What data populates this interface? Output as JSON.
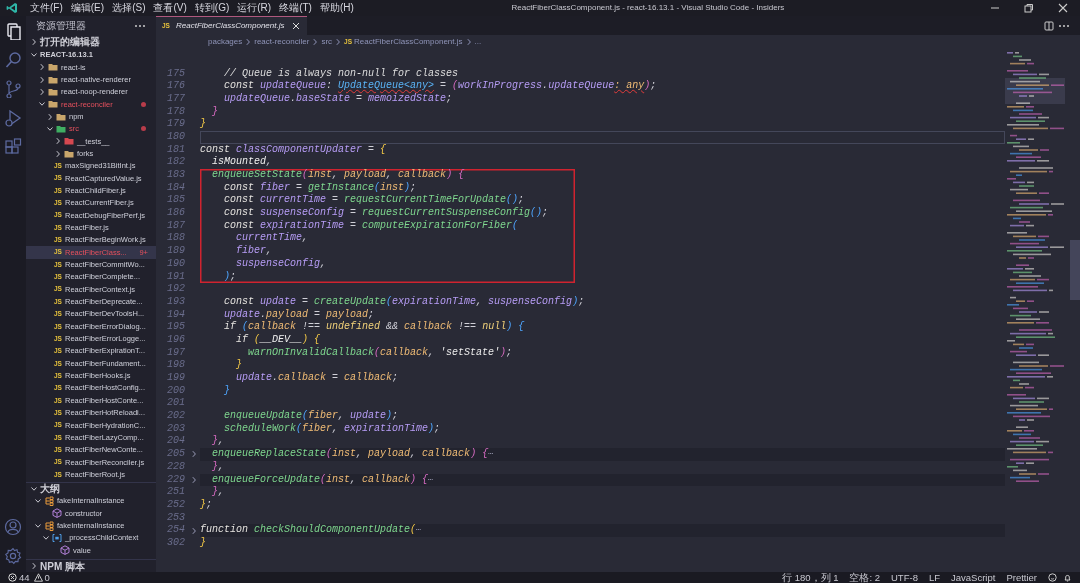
{
  "title_bar": {
    "menu": [
      "文件(F)",
      "编辑(E)",
      "选择(S)",
      "查看(V)",
      "转到(G)",
      "运行(R)",
      "终端(T)",
      "帮助(H)"
    ],
    "title": "ReactFiberClassComponent.js - react-16.13.1 - Visual Studio Code - Insiders"
  },
  "activity_bar": {
    "top": [
      {
        "kind": "files",
        "selected": true
      },
      {
        "kind": "search",
        "selected": false
      },
      {
        "kind": "source-control",
        "selected": false
      },
      {
        "kind": "run",
        "selected": false
      },
      {
        "kind": "extensions",
        "selected": false
      }
    ],
    "bottom": [
      {
        "kind": "account"
      },
      {
        "kind": "settings"
      }
    ]
  },
  "explorer": {
    "title": "资源管理器",
    "open_editors": {
      "title": "打开的编辑器",
      "expanded": false
    },
    "project": {
      "title": "REACT-16.13.1",
      "expanded": true,
      "children": [
        {
          "label": "react-is",
          "kind": "folder",
          "expanded": false,
          "selected": false,
          "modified": false
        },
        {
          "label": "react-native-renderer",
          "kind": "folder",
          "expanded": false,
          "selected": false,
          "modified": false
        },
        {
          "label": "react-noop-renderer",
          "kind": "folder",
          "expanded": false,
          "selected": false,
          "modified": false
        },
        {
          "label": "react-reconciler",
          "kind": "folder",
          "expanded": true,
          "selected": false,
          "modified": true,
          "children": [
            {
              "label": "npm",
              "kind": "folder",
              "expanded": false,
              "selected": false,
              "modified": false
            },
            {
              "label": "src",
              "kind": "src-folder",
              "expanded": true,
              "selected": false,
              "modified": true,
              "children": [
                {
                  "label": "__tests__",
                  "kind": "test-folder",
                  "expanded": false,
                  "selected": false,
                  "modified": false
                },
                {
                  "label": "forks",
                  "kind": "folder",
                  "expanded": false,
                  "selected": false,
                  "modified": false
                },
                {
                  "label": "maxSigned31BitInt.js",
                  "kind": "file",
                  "icon_label": "JS",
                  "selected": false,
                  "modified": false
                },
                {
                  "label": "ReactCapturedValue.js",
                  "kind": "file",
                  "icon_label": "JS",
                  "selected": false,
                  "modified": false
                },
                {
                  "label": "ReactChildFiber.js",
                  "kind": "file",
                  "icon_label": "JS",
                  "selected": false,
                  "modified": false
                },
                {
                  "label": "ReactCurrentFiber.js",
                  "kind": "file",
                  "icon_label": "JS",
                  "selected": false,
                  "modified": false
                },
                {
                  "label": "ReactDebugFiberPerf.js",
                  "kind": "file",
                  "icon_label": "JS",
                  "selected": false,
                  "modified": false
                },
                {
                  "label": "ReactFiber.js",
                  "kind": "file",
                  "icon_label": "JS",
                  "selected": false,
                  "modified": false
                },
                {
                  "label": "ReactFiberBeginWork.js",
                  "kind": "file",
                  "icon_label": "JS",
                  "selected": false,
                  "modified": false
                },
                {
                  "label": "ReactFiberClass...",
                  "kind": "file",
                  "icon_label": "JS",
                  "selected": true,
                  "modified": true,
                  "badge": "9+"
                },
                {
                  "label": "ReactFiberCommitWo...",
                  "kind": "file",
                  "icon_label": "JS",
                  "selected": false,
                  "modified": false
                },
                {
                  "label": "ReactFiberComplete...",
                  "kind": "file",
                  "icon_label": "JS",
                  "selected": false,
                  "modified": false
                },
                {
                  "label": "ReactFiberContext.js",
                  "kind": "file",
                  "icon_label": "JS",
                  "selected": false,
                  "modified": false
                },
                {
                  "label": "ReactFiberDeprecate...",
                  "kind": "file",
                  "icon_label": "JS",
                  "selected": false,
                  "modified": false
                },
                {
                  "label": "ReactFiberDevToolsH...",
                  "kind": "file",
                  "icon_label": "JS",
                  "selected": false,
                  "modified": false
                },
                {
                  "label": "ReactFiberErrorDialog...",
                  "kind": "file",
                  "icon_label": "JS",
                  "selected": false,
                  "modified": false
                },
                {
                  "label": "ReactFiberErrorLogge...",
                  "kind": "file",
                  "icon_label": "JS",
                  "selected": false,
                  "modified": false
                },
                {
                  "label": "ReactFiberExpirationT...",
                  "kind": "file",
                  "icon_label": "JS",
                  "selected": false,
                  "modified": false
                },
                {
                  "label": "ReactFiberFundament...",
                  "kind": "file",
                  "icon_label": "JS",
                  "selected": false,
                  "modified": false
                },
                {
                  "label": "ReactFiberHooks.js",
                  "kind": "file",
                  "icon_label": "JS",
                  "selected": false,
                  "modified": false
                },
                {
                  "label": "ReactFiberHostConfig...",
                  "kind": "file",
                  "icon_label": "JS",
                  "selected": false,
                  "modified": false
                },
                {
                  "label": "ReactFiberHostConte...",
                  "kind": "file",
                  "icon_label": "JS",
                  "selected": false,
                  "modified": false
                },
                {
                  "label": "ReactFiberHotReloadi...",
                  "kind": "file",
                  "icon_label": "JS",
                  "selected": false,
                  "modified": false
                },
                {
                  "label": "ReactFiberHydrationC...",
                  "kind": "file",
                  "icon_label": "JS",
                  "selected": false,
                  "modified": false
                },
                {
                  "label": "ReactFiberLazyComp...",
                  "kind": "file",
                  "icon_label": "JS",
                  "selected": false,
                  "modified": false
                },
                {
                  "label": "ReactFiberNewConte...",
                  "kind": "file",
                  "icon_label": "JS",
                  "selected": false,
                  "modified": false
                },
                {
                  "label": "ReactFiberReconciler.js",
                  "kind": "file",
                  "icon_label": "JS",
                  "selected": false,
                  "modified": false
                },
                {
                  "label": "ReactFiberRoot.js",
                  "kind": "file",
                  "icon_label": "JS",
                  "selected": false,
                  "modified": false
                }
              ]
            }
          ]
        }
      ]
    }
  },
  "outline": {
    "title": "大纲",
    "expanded": true,
    "children": [
      {
        "label": "fakeInternalInstance",
        "kind": "object",
        "expanded": true,
        "children": [
          {
            "label": "constructor",
            "kind": "method"
          }
        ]
      },
      {
        "label": "fakeInternalInstance",
        "kind": "object",
        "expanded": true,
        "children": [
          {
            "label": "_processChildContext",
            "kind": "variable",
            "expanded": true,
            "children": [
              {
                "label": "value",
                "kind": "method"
              }
            ]
          }
        ]
      }
    ]
  },
  "npm_scripts": {
    "title": "NPM 脚本",
    "expanded": false
  },
  "tabs": [
    {
      "label": "ReactFiberClassComponent.js",
      "icon_label": "JS",
      "selected": true
    }
  ],
  "breadcrumb": [
    {
      "text": "packages"
    },
    {
      "text": "react-reconciler"
    },
    {
      "text": "src"
    },
    {
      "text": "ReactFiberClassComponent.js",
      "icon_label": "JS"
    },
    {
      "text": "..."
    }
  ],
  "editor": {
    "lines": [
      {
        "number": "175",
        "tokens": [
          {
            "kind": "comment",
            "text": "    // Queue is always non-null for classes"
          }
        ]
      },
      {
        "number": "176",
        "tokens": [
          {
            "kind": "keyword",
            "text": "    const "
          },
          {
            "kind": "variable",
            "text": "updateQueue"
          },
          {
            "kind": "punct",
            "text": ": "
          },
          {
            "kind": "typeerror",
            "text": "UpdateQueue<any>"
          },
          {
            "kind": "punct",
            "text": " = "
          },
          {
            "kind": "brace2",
            "text": "("
          },
          {
            "kind": "variable",
            "text": "workInProgress"
          },
          {
            "kind": "punct",
            "text": "."
          },
          {
            "kind": "variable",
            "text": "updateQueue"
          },
          {
            "kind": "paramerror",
            "text": ": any"
          },
          {
            "kind": "brace2",
            "text": ")"
          },
          {
            "kind": "punct",
            "text": ";"
          }
        ]
      },
      {
        "number": "177",
        "tokens": [
          {
            "kind": "variable",
            "text": "    updateQueue"
          },
          {
            "kind": "punct",
            "text": "."
          },
          {
            "kind": "variable",
            "text": "baseState"
          },
          {
            "kind": "punct",
            "text": " = "
          },
          {
            "kind": "variable",
            "text": "memoizedState"
          },
          {
            "kind": "punct",
            "text": ";"
          }
        ]
      },
      {
        "number": "178",
        "tokens": [
          {
            "kind": "brace2",
            "text": "  }"
          }
        ]
      },
      {
        "number": "179",
        "tokens": [
          {
            "kind": "brace1",
            "text": "}"
          }
        ]
      },
      {
        "number": "180",
        "current": true
      },
      {
        "number": "181",
        "tokens": [
          {
            "kind": "keyword",
            "text": "const "
          },
          {
            "kind": "variable",
            "text": "classComponentUpdater"
          },
          {
            "kind": "punct",
            "text": " = "
          },
          {
            "kind": "brace1",
            "text": "{"
          }
        ]
      },
      {
        "number": "182",
        "tokens": [
          {
            "kind": "plain",
            "text": "  isMounted"
          },
          {
            "kind": "punct",
            "text": ","
          }
        ]
      },
      {
        "number": "183",
        "boxed": true,
        "tokens": [
          {
            "kind": "function",
            "text": "  enqueueSetState"
          },
          {
            "kind": "brace2",
            "text": "("
          },
          {
            "kind": "param",
            "text": "inst"
          },
          {
            "kind": "punct",
            "text": ", "
          },
          {
            "kind": "param",
            "text": "payload"
          },
          {
            "kind": "punct",
            "text": ", "
          },
          {
            "kind": "param",
            "text": "callback"
          },
          {
            "kind": "brace2",
            "text": ") {"
          }
        ]
      },
      {
        "number": "184",
        "boxed": true,
        "tokens": [
          {
            "kind": "keyword",
            "text": "    const "
          },
          {
            "kind": "variable",
            "text": "fiber"
          },
          {
            "kind": "punct",
            "text": " = "
          },
          {
            "kind": "function",
            "text": "getInstance"
          },
          {
            "kind": "brace3",
            "text": "("
          },
          {
            "kind": "param",
            "text": "inst"
          },
          {
            "kind": "brace3",
            "text": ")"
          },
          {
            "kind": "punct",
            "text": ";"
          }
        ]
      },
      {
        "number": "185",
        "boxed": true,
        "tokens": [
          {
            "kind": "keyword",
            "text": "    const "
          },
          {
            "kind": "variable",
            "text": "currentTime"
          },
          {
            "kind": "punct",
            "text": " = "
          },
          {
            "kind": "function",
            "text": "requestCurrentTimeForUpdate"
          },
          {
            "kind": "brace3",
            "text": "()"
          },
          {
            "kind": "punct",
            "text": ";"
          }
        ]
      },
      {
        "number": "186",
        "boxed": true,
        "tokens": [
          {
            "kind": "keyword",
            "text": "    const "
          },
          {
            "kind": "variable",
            "text": "suspenseConfig"
          },
          {
            "kind": "punct",
            "text": " = "
          },
          {
            "kind": "function",
            "text": "requestCurrentSuspenseConfig"
          },
          {
            "kind": "brace3",
            "text": "()"
          },
          {
            "kind": "punct",
            "text": ";"
          }
        ]
      },
      {
        "number": "187",
        "boxed": true,
        "tokens": [
          {
            "kind": "keyword",
            "text": "    const "
          },
          {
            "kind": "variable",
            "text": "expirationTime"
          },
          {
            "kind": "punct",
            "text": " = "
          },
          {
            "kind": "function",
            "text": "computeExpirationForFiber"
          },
          {
            "kind": "brace3",
            "text": "("
          }
        ]
      },
      {
        "number": "188",
        "boxed": true,
        "tokens": [
          {
            "kind": "variable",
            "text": "      currentTime"
          },
          {
            "kind": "punct",
            "text": ","
          }
        ]
      },
      {
        "number": "189",
        "boxed": true,
        "tokens": [
          {
            "kind": "variable",
            "text": "      fiber"
          },
          {
            "kind": "punct",
            "text": ","
          }
        ]
      },
      {
        "number": "190",
        "boxed": true,
        "tokens": [
          {
            "kind": "variable",
            "text": "      suspenseConfig"
          },
          {
            "kind": "punct",
            "text": ","
          }
        ]
      },
      {
        "number": "191",
        "boxed": true,
        "tokens": [
          {
            "kind": "brace3",
            "text": "    )"
          },
          {
            "kind": "punct",
            "text": ";"
          }
        ]
      },
      {
        "number": "192"
      },
      {
        "number": "193",
        "tokens": [
          {
            "kind": "keyword",
            "text": "    const "
          },
          {
            "kind": "variable",
            "text": "update"
          },
          {
            "kind": "punct",
            "text": " = "
          },
          {
            "kind": "function",
            "text": "createUpdate"
          },
          {
            "kind": "brace3",
            "text": "("
          },
          {
            "kind": "variable",
            "text": "expirationTime"
          },
          {
            "kind": "punct",
            "text": ", "
          },
          {
            "kind": "variable",
            "text": "suspenseConfig"
          },
          {
            "kind": "brace3",
            "text": ")"
          },
          {
            "kind": "punct",
            "text": ";"
          }
        ]
      },
      {
        "number": "194",
        "tokens": [
          {
            "kind": "variable",
            "text": "    update"
          },
          {
            "kind": "punct",
            "text": "."
          },
          {
            "kind": "param",
            "text": "payload"
          },
          {
            "kind": "punct",
            "text": " = "
          },
          {
            "kind": "param",
            "text": "payload"
          },
          {
            "kind": "punct",
            "text": ";"
          }
        ]
      },
      {
        "number": "195",
        "tokens": [
          {
            "kind": "keyword",
            "text": "    if "
          },
          {
            "kind": "brace3",
            "text": "("
          },
          {
            "kind": "param",
            "text": "callback"
          },
          {
            "kind": "punct",
            "text": " !== "
          },
          {
            "kind": "literal",
            "text": "undefined"
          },
          {
            "kind": "punct",
            "text": " && "
          },
          {
            "kind": "param",
            "text": "callback"
          },
          {
            "kind": "punct",
            "text": " !== "
          },
          {
            "kind": "literal",
            "text": "null"
          },
          {
            "kind": "brace3",
            "text": ") {"
          }
        ]
      },
      {
        "number": "196",
        "tokens": [
          {
            "kind": "keyword",
            "text": "      if "
          },
          {
            "kind": "brace1",
            "text": "("
          },
          {
            "kind": "plain",
            "text": "__DEV__"
          },
          {
            "kind": "brace1",
            "text": ") {"
          }
        ]
      },
      {
        "number": "197",
        "tokens": [
          {
            "kind": "function",
            "text": "        warnOnInvalidCallback"
          },
          {
            "kind": "brace2",
            "text": "("
          },
          {
            "kind": "param",
            "text": "callback"
          },
          {
            "kind": "punct",
            "text": ", "
          },
          {
            "kind": "string",
            "text": "'setState'"
          },
          {
            "kind": "brace2",
            "text": ")"
          },
          {
            "kind": "punct",
            "text": ";"
          }
        ]
      },
      {
        "number": "198",
        "tokens": [
          {
            "kind": "brace1",
            "text": "      }"
          }
        ]
      },
      {
        "number": "199",
        "tokens": [
          {
            "kind": "variable",
            "text": "      update"
          },
          {
            "kind": "punct",
            "text": "."
          },
          {
            "kind": "param",
            "text": "callback"
          },
          {
            "kind": "punct",
            "text": " = "
          },
          {
            "kind": "param",
            "text": "callback"
          },
          {
            "kind": "punct",
            "text": ";"
          }
        ]
      },
      {
        "number": "200",
        "tokens": [
          {
            "kind": "brace3",
            "text": "    }"
          }
        ]
      },
      {
        "number": "201"
      },
      {
        "number": "202",
        "tokens": [
          {
            "kind": "function",
            "text": "    enqueueUpdate"
          },
          {
            "kind": "brace3",
            "text": "("
          },
          {
            "kind": "param",
            "text": "fiber"
          },
          {
            "kind": "punct",
            "text": ", "
          },
          {
            "kind": "variable",
            "text": "update"
          },
          {
            "kind": "brace3",
            "text": ")"
          },
          {
            "kind": "punct",
            "text": ";"
          }
        ]
      },
      {
        "number": "203",
        "tokens": [
          {
            "kind": "function",
            "text": "    scheduleWork"
          },
          {
            "kind": "brace3",
            "text": "("
          },
          {
            "kind": "param",
            "text": "fiber"
          },
          {
            "kind": "punct",
            "text": ", "
          },
          {
            "kind": "variable",
            "text": "expirationTime"
          },
          {
            "kind": "brace3",
            "text": ")"
          },
          {
            "kind": "punct",
            "text": ";"
          }
        ]
      },
      {
        "number": "204",
        "tokens": [
          {
            "kind": "brace2",
            "text": "  }"
          },
          {
            "kind": "punct",
            "text": ","
          }
        ]
      },
      {
        "number": "205",
        "folded": true,
        "tokens": [
          {
            "kind": "function",
            "text": "  enqueueReplaceState"
          },
          {
            "kind": "brace2",
            "text": "("
          },
          {
            "kind": "param",
            "text": "inst"
          },
          {
            "kind": "punct",
            "text": ", "
          },
          {
            "kind": "param",
            "text": "payload"
          },
          {
            "kind": "punct",
            "text": ", "
          },
          {
            "kind": "param",
            "text": "callback"
          },
          {
            "kind": "brace2",
            "text": ") {"
          },
          {
            "kind": "fold",
            "text": "⋯"
          }
        ]
      },
      {
        "number": "228",
        "tokens": [
          {
            "kind": "brace2",
            "text": "  }"
          },
          {
            "kind": "punct",
            "text": ","
          }
        ]
      },
      {
        "number": "229",
        "folded": true,
        "tokens": [
          {
            "kind": "function",
            "text": "  enqueueForceUpdate"
          },
          {
            "kind": "brace2",
            "text": "("
          },
          {
            "kind": "param",
            "text": "inst"
          },
          {
            "kind": "punct",
            "text": ", "
          },
          {
            "kind": "param",
            "text": "callback"
          },
          {
            "kind": "brace2",
            "text": ") {"
          },
          {
            "kind": "fold",
            "text": "⋯"
          }
        ]
      },
      {
        "number": "251",
        "tokens": [
          {
            "kind": "brace2",
            "text": "  }"
          },
          {
            "kind": "punct",
            "text": ","
          }
        ]
      },
      {
        "number": "252",
        "tokens": [
          {
            "kind": "brace1",
            "text": "}"
          },
          {
            "kind": "punct",
            "text": ";"
          }
        ]
      },
      {
        "number": "253"
      },
      {
        "number": "254",
        "folded": true,
        "tokens": [
          {
            "kind": "keyword",
            "text": "function "
          },
          {
            "kind": "function",
            "text": "checkShouldComponentUpdate"
          },
          {
            "kind": "brace1",
            "text": "("
          },
          {
            "kind": "fold",
            "text": "⋯"
          }
        ]
      },
      {
        "number": "302",
        "tokens": [
          {
            "kind": "brace1",
            "text": "}"
          }
        ]
      }
    ]
  },
  "status_bar": {
    "errors": "44",
    "warnings": "0",
    "items": [
      "行 180，列 1",
      "空格: 2",
      "UTF-8",
      "LF",
      "JavaScript",
      "Prettier"
    ]
  }
}
